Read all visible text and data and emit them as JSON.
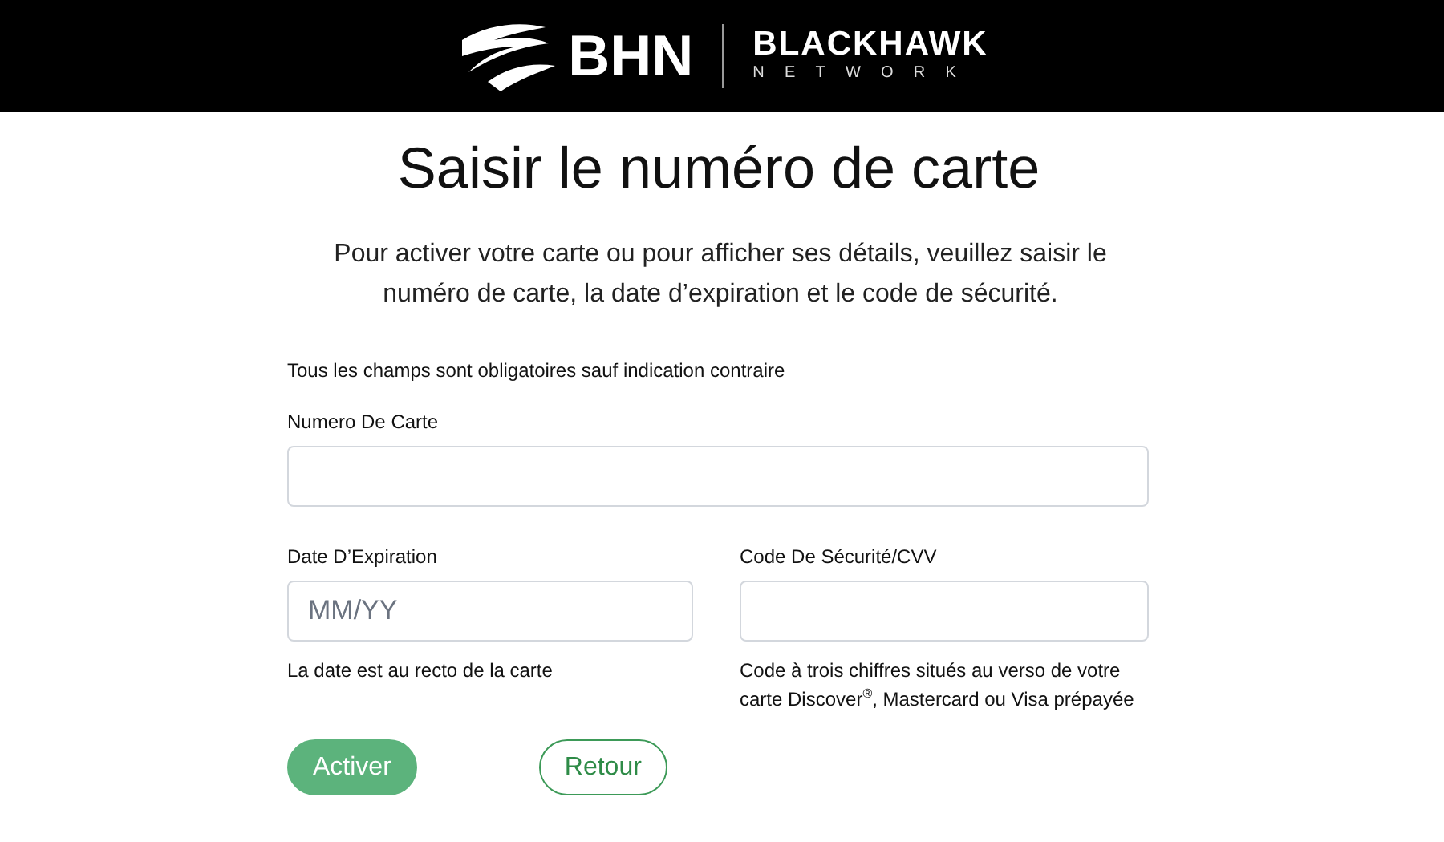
{
  "header": {
    "logo_mark": "BHN",
    "brand_name": "BLACKHAWK",
    "brand_sub": "NETWORK"
  },
  "title": "Saisir le numéro de carte",
  "intro": "Pour activer votre carte ou pour afficher ses détails, veuillez saisir le numéro de carte, la date d’expiration et le code de sécurité.",
  "required_note": "Tous les champs sont obligatoires sauf indication contraire",
  "fields": [
    {
      "label": "Numero De Carte"
    },
    {
      "label": "Date D’Expiration",
      "placeholder": "MM/YY",
      "help": "La date est au recto de la carte"
    },
    {
      "label": "Code De Sécurité/CVV",
      "help": "Code à trois chiffres situés au verso de votre carte Discover$^{®}$, Mastercard ou Visa prépayée"
    }
  ],
  "buttons": [
    {
      "label": "Activer",
      "kind": "primary"
    },
    {
      "label": "Retour",
      "kind": "secondary"
    }
  ]
}
